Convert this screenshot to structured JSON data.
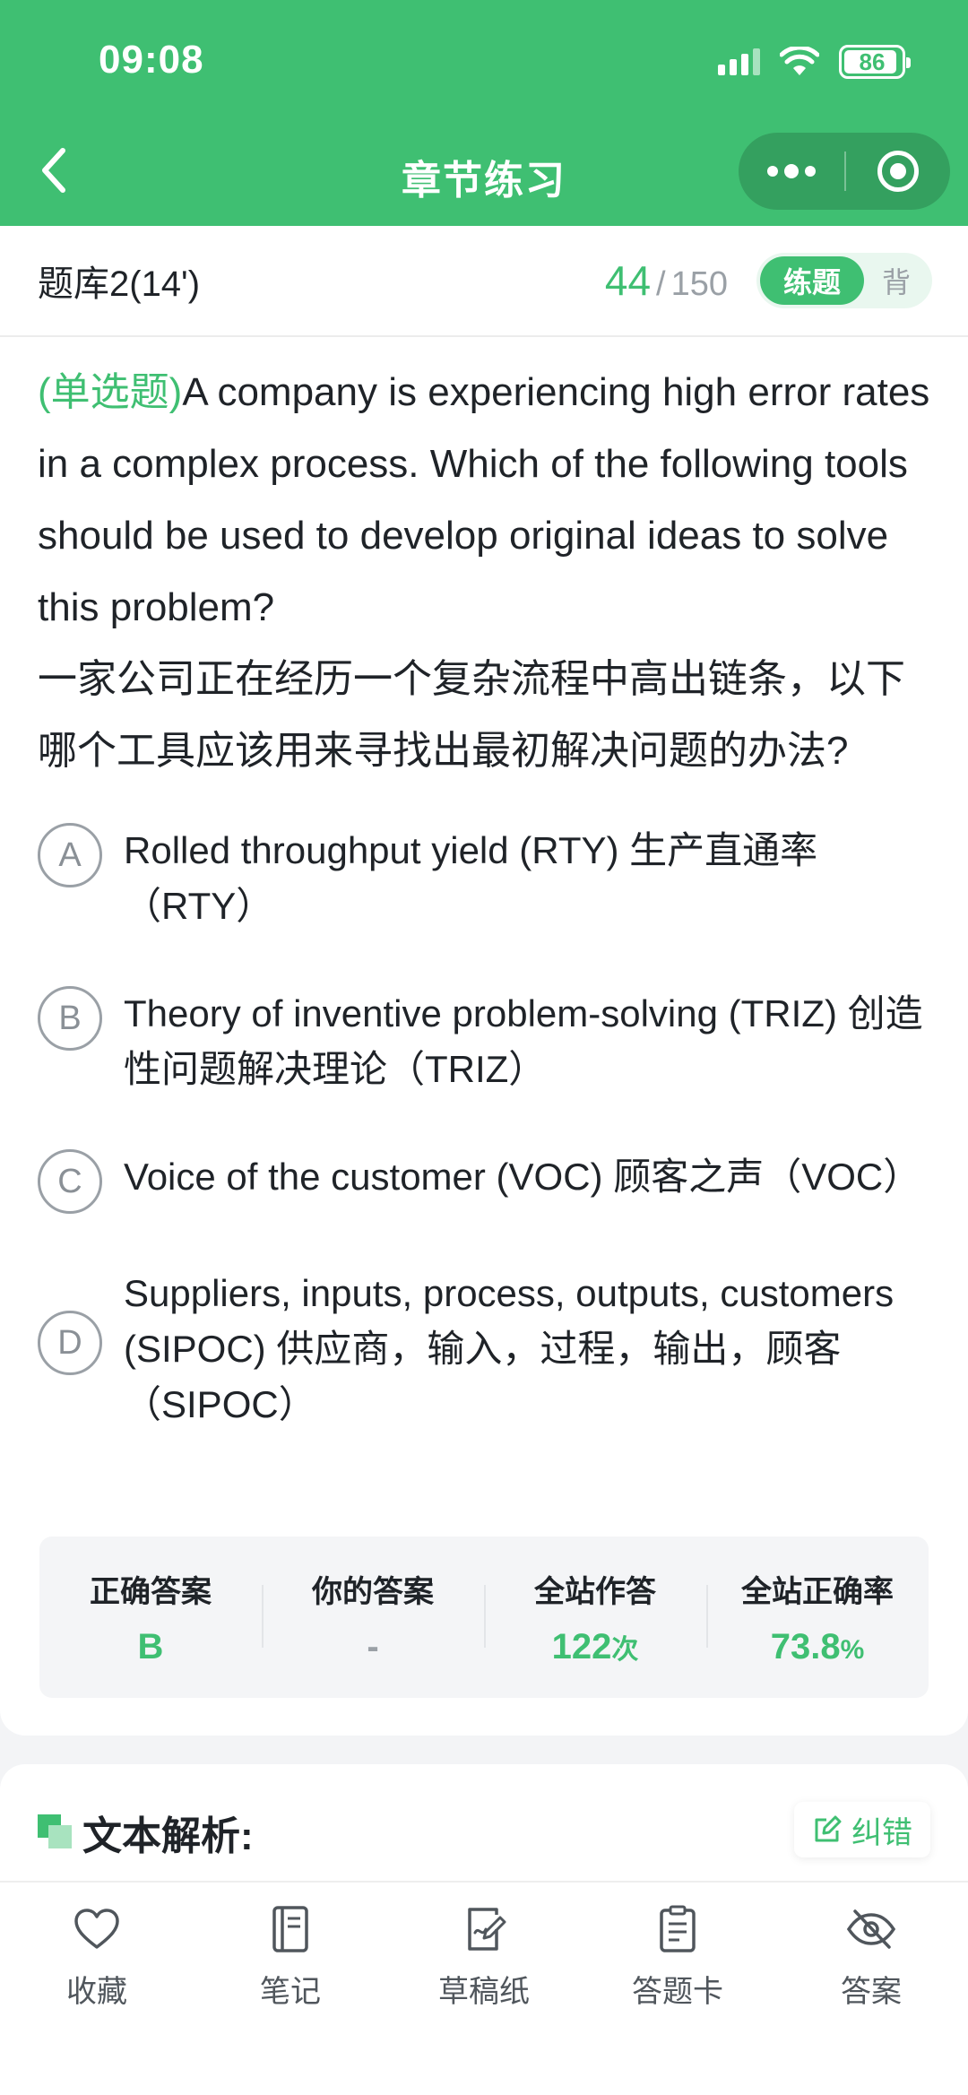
{
  "status": {
    "time": "09:08",
    "battery": "86"
  },
  "nav": {
    "title": "章节练习"
  },
  "subheader": {
    "bank_title": "题库2(14')",
    "current": "44",
    "separator": "/",
    "total": "150",
    "mode_practice": "练题",
    "mode_recite": "背"
  },
  "question": {
    "type": "(单选题)",
    "text_en": "A company is experiencing high error rates in a complex process. Which of the following tools should be used to develop original ideas to solve this problem?",
    "text_zh": "一家公司正在经历一个复杂流程中高出链条，以下哪个工具应该用来寻找出最初解决问题的办法?"
  },
  "options": [
    {
      "letter": "A",
      "text": "Rolled throughput yield (RTY) 生产直通率（RTY）"
    },
    {
      "letter": "B",
      "text": "Theory of inventive problem-solving (TRIZ) 创造性问题解决理论（TRIZ）"
    },
    {
      "letter": "C",
      "text": "Voice of the customer (VOC) 顾客之声（VOC）"
    },
    {
      "letter": "D",
      "text": "Suppliers, inputs, process, outputs, customers (SIPOC) 供应商，输入，过程，输出，顾客（SIPOC）"
    }
  ],
  "stats": {
    "correct_label": "正确答案",
    "correct_value": "B",
    "yours_label": "你的答案",
    "yours_value": "-",
    "attempts_label": "全站作答",
    "attempts_value": "122",
    "attempts_unit": "次",
    "rate_label": "全站正确率",
    "rate_value": "73.8",
    "rate_unit": "%"
  },
  "analysis": {
    "title": "文本解析:",
    "correct_button": "纠错"
  },
  "tabbar": {
    "favorite": "收藏",
    "notes": "笔记",
    "scratch": "草稿纸",
    "answer_card": "答题卡",
    "answer": "答案"
  },
  "colors": {
    "brand": "#3fbf72",
    "muted": "#9aa0a6"
  }
}
